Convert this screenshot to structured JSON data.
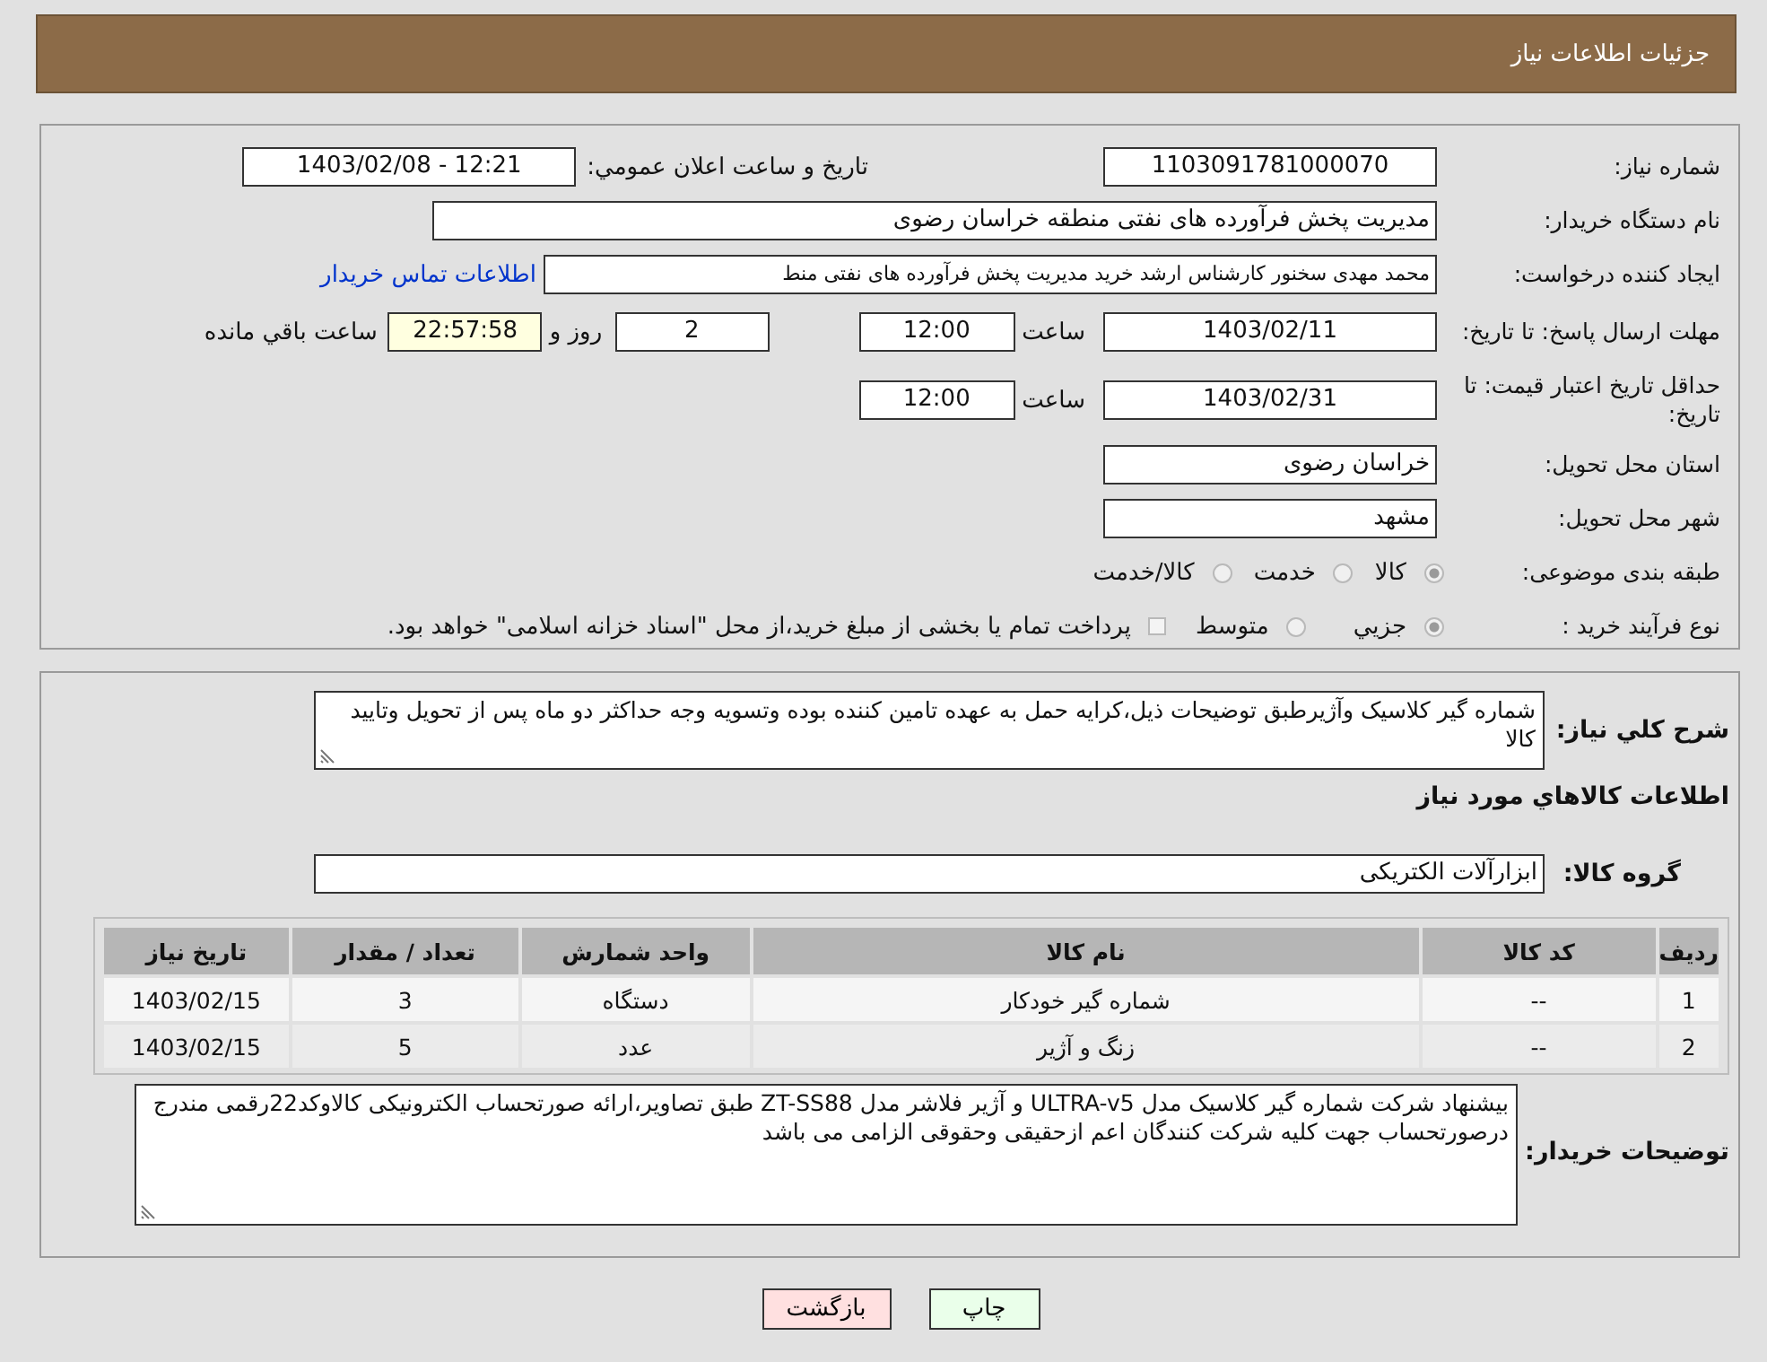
{
  "header": {
    "title": "جزئیات اطلاعات نیاز"
  },
  "details": [
    {
      "label": "شماره نیاز:",
      "items": [
        {
          "kind": "field",
          "value": "1103091781000070"
        },
        {
          "kind": "text",
          "text": "تاريخ و ساعت اعلان عمومي:"
        },
        {
          "kind": "field",
          "value": "1403/02/08 - 12:21"
        }
      ]
    },
    {
      "label": "نام دستگاه خریدار:",
      "items": [
        {
          "kind": "field",
          "value": "مدیریت پخش فرآورده های نفتی منطقه خراسان رضوی"
        }
      ]
    },
    {
      "label": "ایجاد کننده درخواست:",
      "items": [
        {
          "kind": "field",
          "value": "محمد مهدی سخنور کارشناس ارشد خرید مدیریت پخش فرآورده های نفتی منط"
        },
        {
          "kind": "link",
          "text": "اطلاعات تماس خریدار"
        }
      ]
    },
    {
      "label": "مهلت ارسال پاسخ: تا تاریخ:",
      "items": [
        {
          "kind": "field",
          "value": "1403/02/11"
        },
        {
          "kind": "text",
          "text": "ساعت"
        },
        {
          "kind": "field",
          "value": "12:00"
        },
        {
          "kind": "field",
          "value": "2"
        },
        {
          "kind": "text",
          "text": "روز و"
        },
        {
          "kind": "field",
          "value": "22:57:58",
          "highlight": true
        },
        {
          "kind": "text",
          "text": "ساعت باقي مانده"
        }
      ]
    },
    {
      "label": "حداقل تاریخ اعتبار قیمت: تا تاریخ:",
      "items": [
        {
          "kind": "field",
          "value": "1403/02/31"
        },
        {
          "kind": "text",
          "text": "ساعت"
        },
        {
          "kind": "field",
          "value": "12:00"
        }
      ]
    },
    {
      "label": "استان محل تحویل:",
      "items": [
        {
          "kind": "field",
          "value": "خراسان رضوی"
        }
      ]
    },
    {
      "label": "شهر محل تحویل:",
      "items": [
        {
          "kind": "field",
          "value": "مشهد"
        }
      ]
    },
    {
      "label": "طبقه بندی موضوعی:",
      "items": [
        {
          "kind": "radio",
          "label": "کالا",
          "selected": true
        },
        {
          "kind": "radio",
          "label": "خدمت",
          "selected": false
        },
        {
          "kind": "radio",
          "label": "کالا/خدمت",
          "selected": false
        }
      ]
    },
    {
      "label": "نوع فرآیند خرید :",
      "items": [
        {
          "kind": "radio",
          "label": "جزيي",
          "selected": true
        },
        {
          "kind": "radio",
          "label": "متوسط",
          "selected": false
        },
        {
          "kind": "checkbox",
          "label": "پرداخت تمام یا بخشی از مبلغ خرید،از محل \"اسناد خزانه اسلامی\" خواهد بود.",
          "checked": false
        }
      ]
    }
  ],
  "need": {
    "label": "شرح کلي نیاز:",
    "value": "شماره گیر کلاسیک وآژیرطبق توضیحات ذیل،کرایه حمل به عهده تامین کننده بوده وتسویه وجه حداکثر دو ماه پس از تحویل وتایید کالا"
  },
  "goods_heading": "اطلاعات کالاهاي مورد نیاز",
  "goods_group": {
    "label": "گروه کالا:",
    "value": "ابزارآلات الکتریکی"
  },
  "table": {
    "columns": [
      "ردیف",
      "کد کالا",
      "نام کالا",
      "واحد شمارش",
      "تعداد / مقدار",
      "تاریخ نیاز"
    ],
    "rows": [
      [
        "1",
        "--",
        "شماره گیر خودکار",
        "دستگاه",
        "3",
        "1403/02/15"
      ],
      [
        "2",
        "--",
        "زنگ و آژیر",
        "عدد",
        "5",
        "1403/02/15"
      ]
    ]
  },
  "buyer_notes": {
    "label": "توضیحات خریدار:",
    "value": "بیشنهاد شرکت شماره گیر کلاسیک مدل ULTRA-v5 و آژیر فلاشر مدل ZT-SS88 طبق تصاویر،ارائه صورتحساب الکترونیکی کالاوکد22رقمی مندرج درصورتحساب جهت کلیه شرکت کنندگان اعم ازحقیقی وحقوقی الزامی می باشد"
  },
  "buttons": [
    {
      "kind": "print",
      "label": "چاپ"
    },
    {
      "kind": "back",
      "label": "بازگشت"
    }
  ]
}
